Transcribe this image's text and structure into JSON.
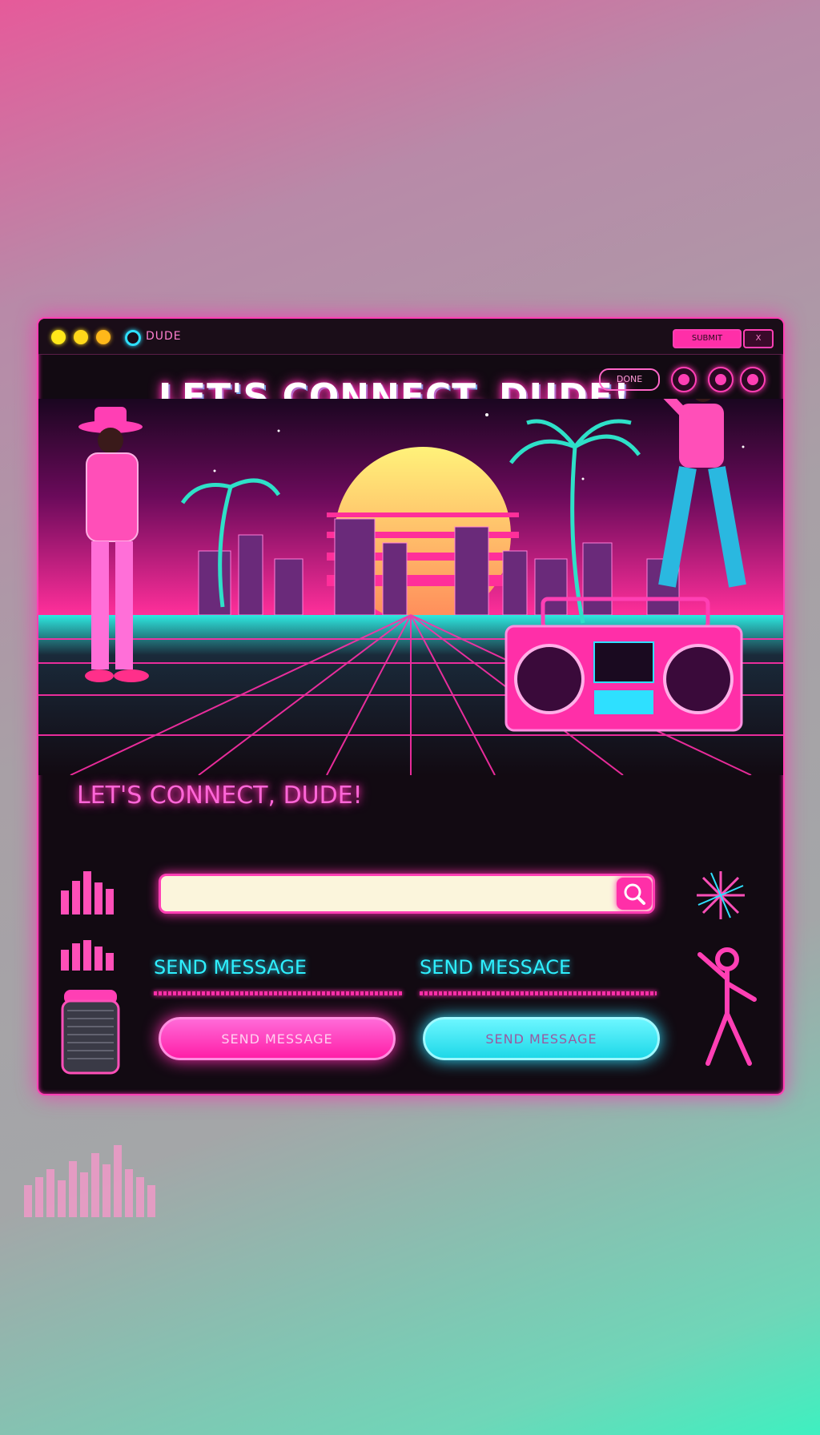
{
  "window": {
    "app_name": "DUDE",
    "titlebar_button_1": "SUBMIT",
    "titlebar_button_2": "X",
    "toolbar_left": "",
    "pill_button": "DONE"
  },
  "hero": {
    "headline": "LET'S CONNECT, DUDE!"
  },
  "form": {
    "sub_headline": "LET'S CONNECT, DUDE!",
    "search_placeholder": "",
    "label_1": "SEND MESSAGE",
    "label_2": "SEND MESSACE",
    "button_1": "SEND MESSAGE",
    "button_2": "SEND MESSAGE"
  },
  "icons": {
    "search": "search-icon",
    "speaker": "speaker-icon",
    "dancer": "dancer-icon",
    "sparkle": "sparkle-icon",
    "equalizer": "equalizer-icon",
    "boombox": "boombox-icon",
    "sun": "sun-icon",
    "palm": "palm-tree-icon"
  },
  "colors": {
    "neon_pink": "#ff2fa8",
    "neon_cyan": "#2ee0ff",
    "sun_yellow": "#ffd860",
    "window_bg": "#120a12"
  }
}
